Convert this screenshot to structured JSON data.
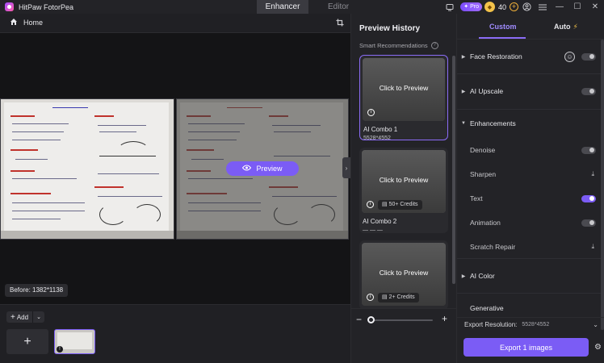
{
  "app": {
    "title": "HitPaw FotorPea"
  },
  "top_tabs": [
    {
      "label": "Enhancer",
      "active": true
    },
    {
      "label": "Editor",
      "active": false
    }
  ],
  "titlebar": {
    "pro_label": "Pro",
    "credits": "40"
  },
  "toolbar": {
    "home_label": "Home"
  },
  "canvas": {
    "preview_label": "Preview",
    "before_label": "Before: 1382*1138"
  },
  "bottom": {
    "add_label": "Add"
  },
  "history": {
    "title": "Preview History",
    "subtitle": "Smart Recommendations",
    "cards": [
      {
        "overlay": "Click to Preview",
        "name": "AI Combo 1",
        "resolution": "5528*4552",
        "credits": "",
        "selected": true
      },
      {
        "overlay": "Click to Preview",
        "name": "AI Combo 2",
        "resolution": "— — —",
        "credits": "50+ Credits",
        "selected": false
      },
      {
        "overlay": "Click to Preview",
        "name": "",
        "resolution": "",
        "credits": "2+ Credits",
        "selected": false
      }
    ]
  },
  "panel": {
    "tabs": {
      "custom": "Custom",
      "auto": "Auto"
    },
    "sections": {
      "face_restoration": "Face Restoration",
      "ai_upscale": "AI Upscale",
      "enhancements": "Enhancements",
      "ai_color": "AI Color",
      "generative": "Generative"
    },
    "items": {
      "denoise": "Denoise",
      "sharpen": "Sharpen",
      "text": "Text",
      "animation": "Animation",
      "scratch_repair": "Scratch Repair"
    },
    "toggles": {
      "face_restoration": false,
      "ai_upscale": false,
      "denoise": false,
      "text": true,
      "animation": false
    },
    "export_resolution_label": "Export Resolution:",
    "export_resolution_value": "5528*4552",
    "export_button": "Export 1 images"
  },
  "colors": {
    "accent": "#7b5cf5",
    "accent_light": "#a08cff",
    "bg": "#1b1b1e"
  }
}
